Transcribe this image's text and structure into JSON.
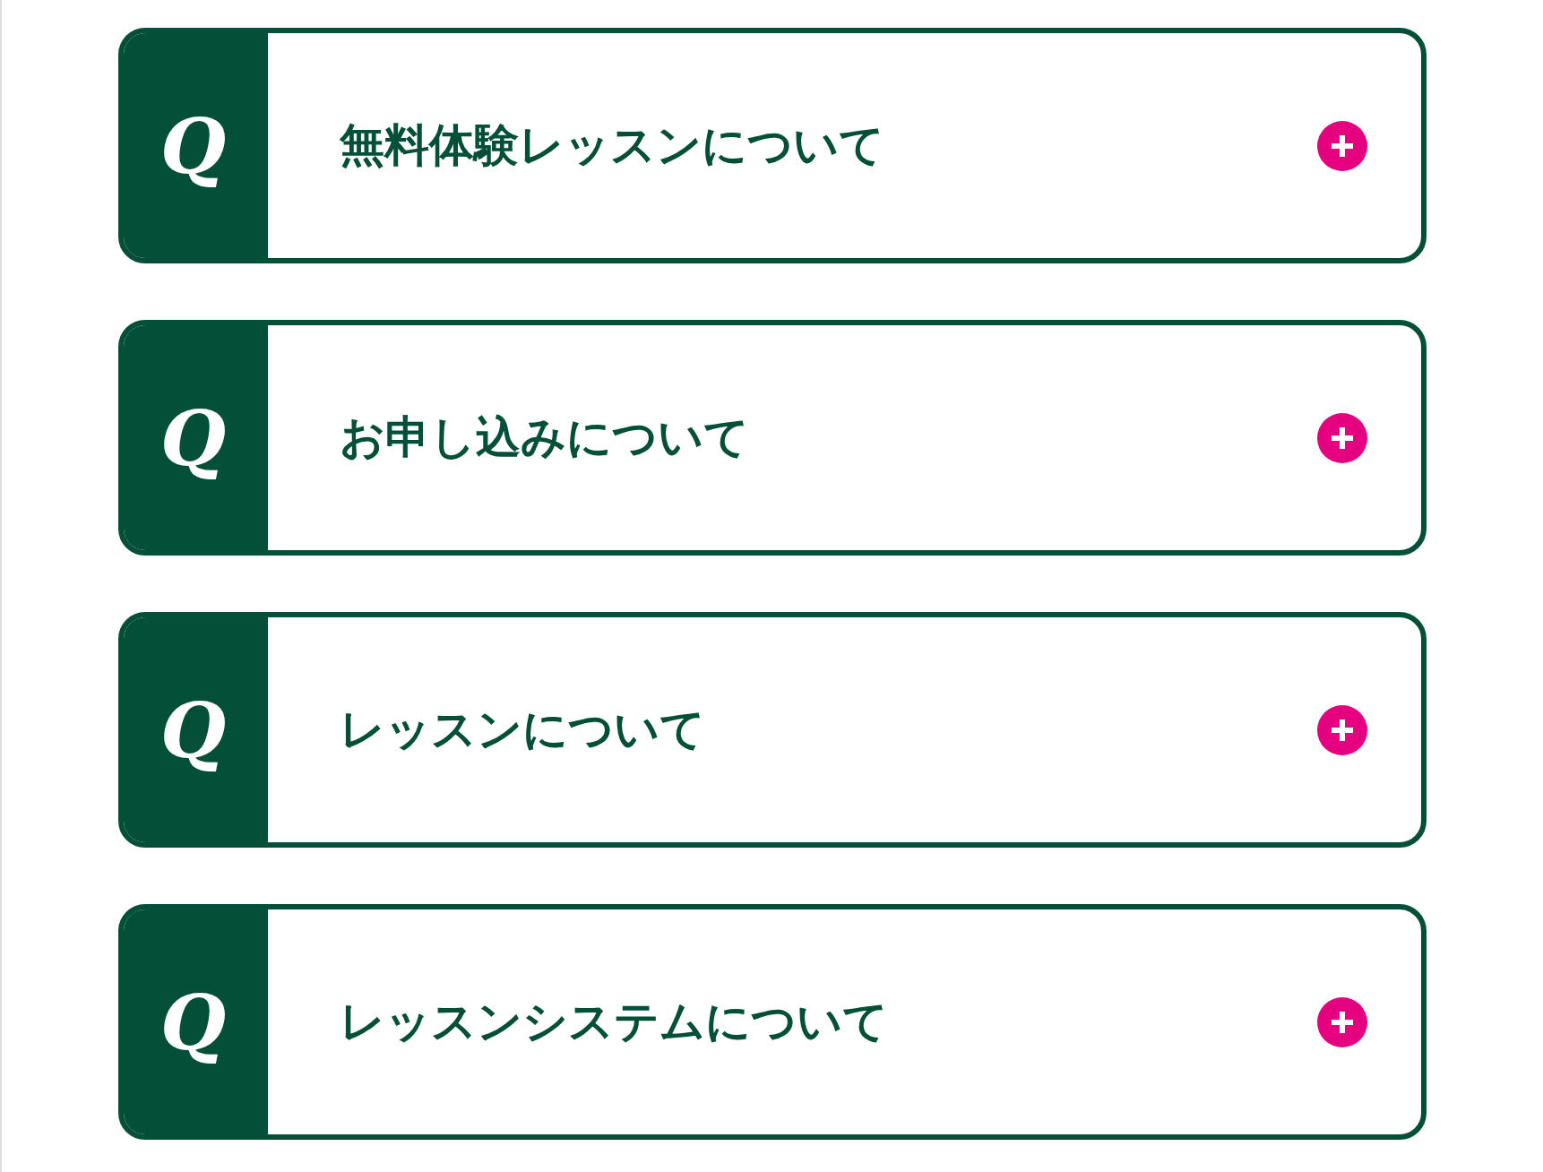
{
  "faq_items": [
    {
      "marker": "Q",
      "question": "無料体験レッスンについて",
      "expanded": false
    },
    {
      "marker": "Q",
      "question": "お申し込みについて",
      "expanded": false
    },
    {
      "marker": "Q",
      "question": "レッスンについて",
      "expanded": false
    },
    {
      "marker": "Q",
      "question": "レッスンシステムについて",
      "expanded": false
    }
  ]
}
